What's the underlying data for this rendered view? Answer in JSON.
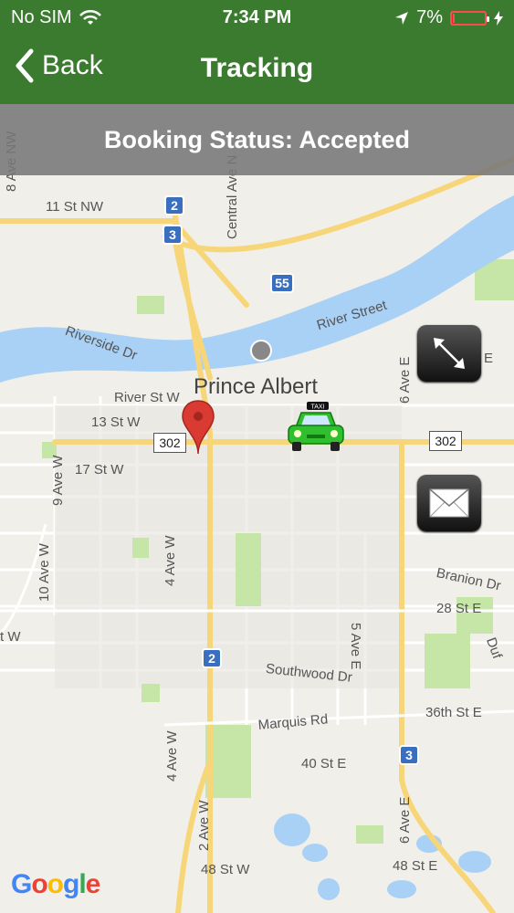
{
  "status_bar": {
    "carrier": "No SIM",
    "time": "7:34 PM",
    "battery_percent": "7%",
    "battery_level": 0.07
  },
  "nav": {
    "back_label": "Back",
    "title": "Tracking"
  },
  "booking": {
    "status_text": "Booking Status: Accepted"
  },
  "map": {
    "city_label": "Prince Albert",
    "labels": {
      "ave_8_nw": "8 Ave NW",
      "st_11_nw": "11 St NW",
      "central_ave_n": "Central Ave N",
      "riverside_dr": "Riverside Dr",
      "river_street": "River Street",
      "river_st_w": "River St W",
      "st_13_w": "13 St W",
      "st_17_w": "17 St W",
      "ave_9_w": "9 Ave W",
      "ave_10_w": "10 Ave W",
      "ave_4_w": "4 Ave W",
      "ave_6_e": "6 Ave E",
      "e_edge": "E",
      "branion_dr": "Branion Dr",
      "st_28_e": "28 St E",
      "ave_5_e": "5 Ave E",
      "southwood_dr": "Southwood Dr",
      "marquis_rd": "Marquis Rd",
      "st_36_e": "36th St E",
      "st_40_e": "40 St E",
      "ave_2_w": "2 Ave W",
      "st_48_w": "48 St W",
      "st_48_e": "48 St E",
      "ave_4_w_south": "4 Ave W",
      "ave_6_e_south": "6 Ave E",
      "w_edge": "t W",
      "dufferin": "Duf"
    },
    "shields": {
      "hwy2_north": "2",
      "hwy3_north": "3",
      "hwy55": "55",
      "hwy2_south": "2",
      "hwy3_south": "3"
    },
    "highway_302_left": "302",
    "highway_302_right": "302",
    "taxi_sign": "TAXI"
  },
  "buttons": {
    "expand_icon": "expand-icon",
    "message_icon": "envelope-icon"
  },
  "attribution": {
    "google": [
      "G",
      "o",
      "o",
      "g",
      "l",
      "e"
    ]
  },
  "colors": {
    "header_green": "#3b7b2f",
    "water": "#a9d0f5",
    "road_yellow": "#f7d67a",
    "park_green": "#c6e6a8",
    "pin_red": "#d93b32",
    "taxi_green": "#2fbf2f"
  }
}
